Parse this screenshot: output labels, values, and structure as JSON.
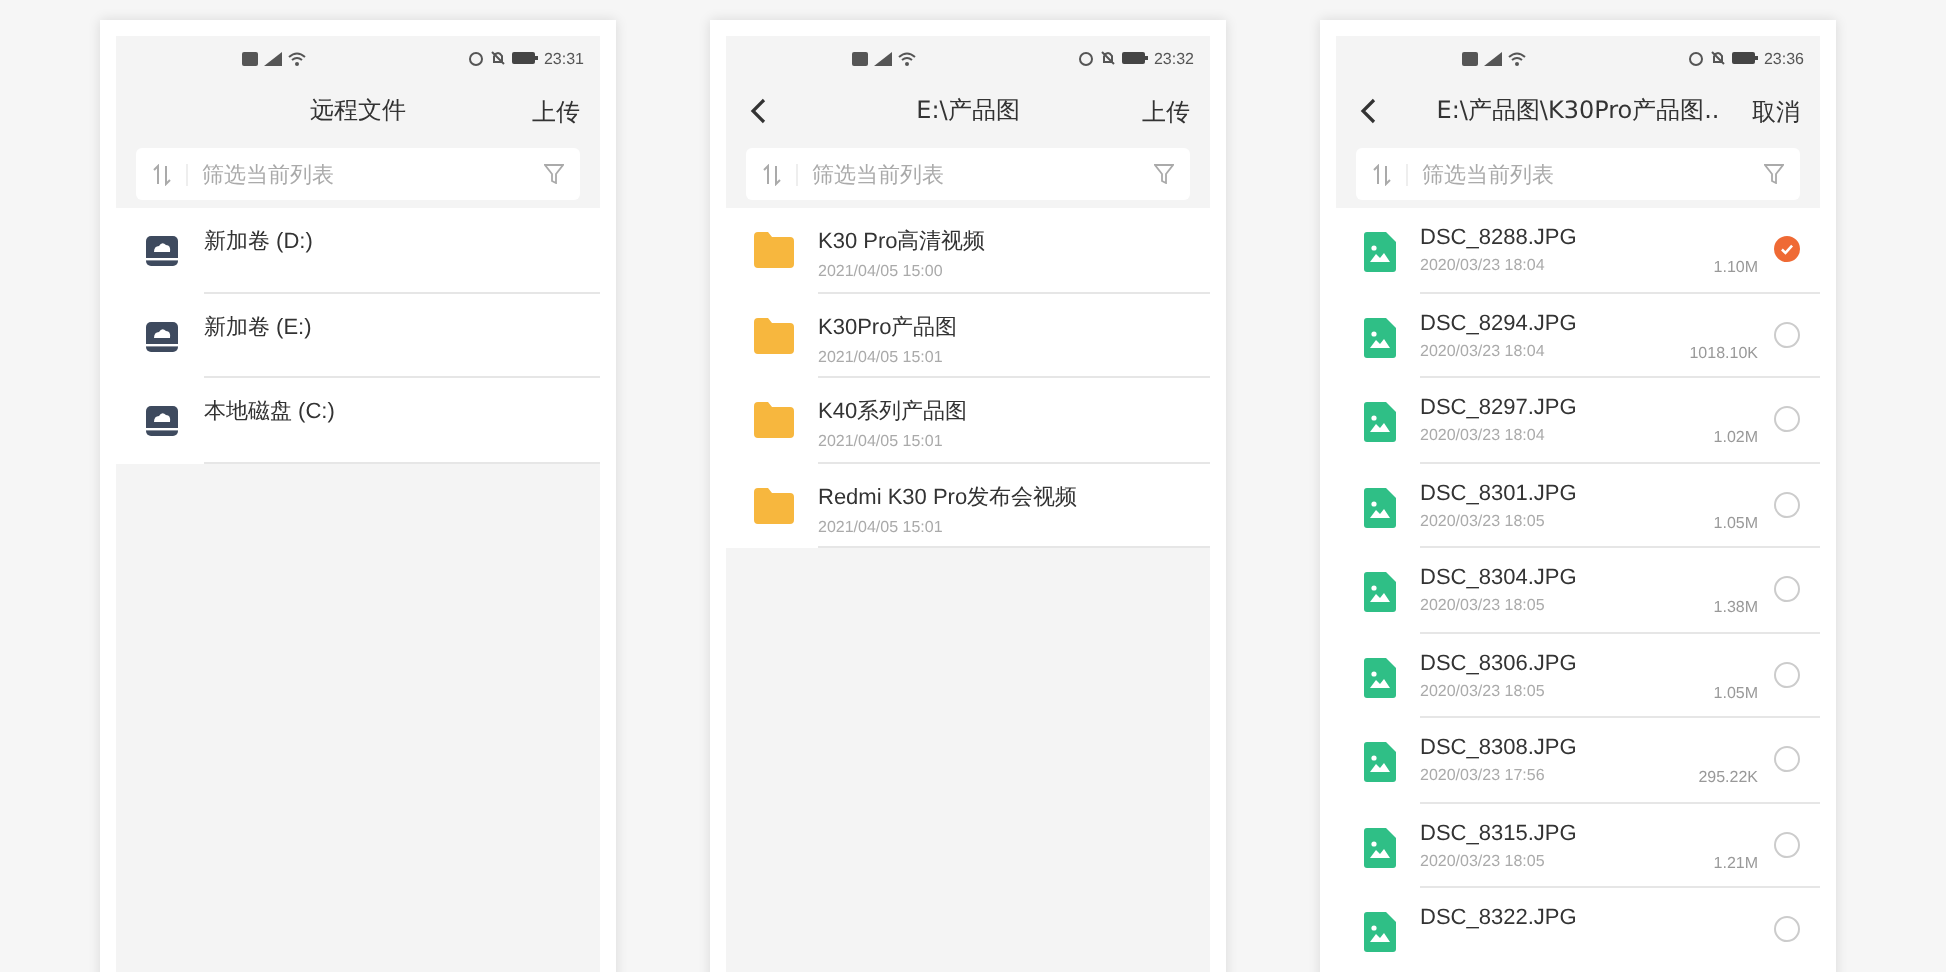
{
  "phones": [
    {
      "status_time": "23:31",
      "back": false,
      "title": "远程文件",
      "action": "上传",
      "search": {
        "placeholder": "筛选当前列表"
      },
      "items": [
        {
          "kind": "drive",
          "name": "新加卷 (D:)"
        },
        {
          "kind": "drive",
          "name": "新加卷 (E:)"
        },
        {
          "kind": "drive",
          "name": "本地磁盘 (C:)"
        }
      ]
    },
    {
      "status_time": "23:32",
      "back": true,
      "title": "E:\\产品图",
      "action": "上传",
      "search": {
        "placeholder": "筛选当前列表"
      },
      "items": [
        {
          "kind": "folder",
          "name": "K30 Pro高清视频",
          "date": "2021/04/05 15:00"
        },
        {
          "kind": "folder",
          "name": "K30Pro产品图",
          "date": "2021/04/05 15:01"
        },
        {
          "kind": "folder",
          "name": "K40系列产品图",
          "date": "2021/04/05 15:01"
        },
        {
          "kind": "folder",
          "name": "Redmi K30 Pro发布会视频",
          "date": "2021/04/05 15:01"
        }
      ]
    },
    {
      "status_time": "23:36",
      "back": true,
      "title": "E:\\产品图\\K30Pro产品图..",
      "action": "取消",
      "search": {
        "placeholder": "筛选当前列表"
      },
      "items": [
        {
          "kind": "file",
          "name": "DSC_8288.JPG",
          "date": "2020/03/23 18:04",
          "size": "1.10M",
          "selected": true
        },
        {
          "kind": "file",
          "name": "DSC_8294.JPG",
          "date": "2020/03/23 18:04",
          "size": "1018.10K",
          "selected": false
        },
        {
          "kind": "file",
          "name": "DSC_8297.JPG",
          "date": "2020/03/23 18:04",
          "size": "1.02M",
          "selected": false
        },
        {
          "kind": "file",
          "name": "DSC_8301.JPG",
          "date": "2020/03/23 18:05",
          "size": "1.05M",
          "selected": false
        },
        {
          "kind": "file",
          "name": "DSC_8304.JPG",
          "date": "2020/03/23 18:05",
          "size": "1.38M",
          "selected": false
        },
        {
          "kind": "file",
          "name": "DSC_8306.JPG",
          "date": "2020/03/23 18:05",
          "size": "1.05M",
          "selected": false
        },
        {
          "kind": "file",
          "name": "DSC_8308.JPG",
          "date": "2020/03/23 17:56",
          "size": "295.22K",
          "selected": false
        },
        {
          "kind": "file",
          "name": "DSC_8315.JPG",
          "date": "2020/03/23 18:05",
          "size": "1.21M",
          "selected": false
        },
        {
          "kind": "file",
          "name": "DSC_8322.JPG",
          "selected": false
        }
      ]
    }
  ]
}
